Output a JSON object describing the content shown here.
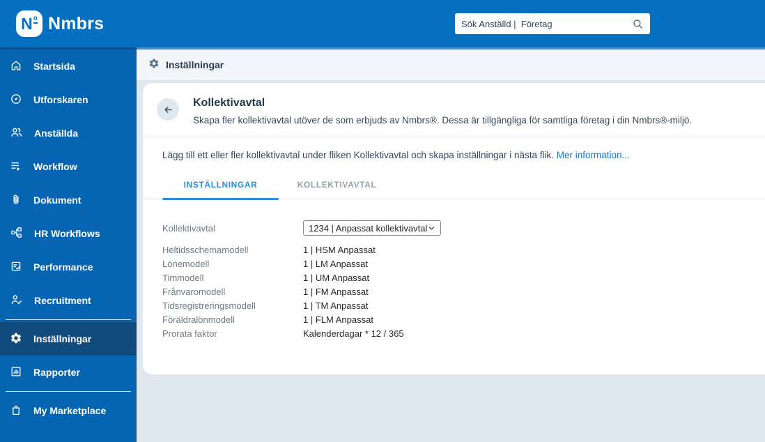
{
  "colors": {
    "brand": "#0670C0",
    "sidebar": "#0665B2",
    "sidebar_selected": "#114A7D",
    "page_bg": "#DFE7F0",
    "tab_active": "#2B90D9",
    "link": "#1878C8"
  },
  "header": {
    "logo_badge": "N",
    "logo_ordinal": "o",
    "logo_text": "Nmbrs",
    "search_placeholder": "Sök Anställd |  Företag"
  },
  "sidebar": {
    "items": [
      {
        "label": "Startsida",
        "icon": "home"
      },
      {
        "label": "Utforskaren",
        "icon": "compass"
      },
      {
        "label": "Anställda",
        "icon": "users"
      },
      {
        "label": "Workflow",
        "icon": "workflow"
      },
      {
        "label": "Dokument",
        "icon": "paperclip"
      },
      {
        "label": "HR Workflows",
        "icon": "hierarchy"
      },
      {
        "label": "Performance",
        "icon": "clipboard-check"
      },
      {
        "label": "Recruitment",
        "icon": "user-check"
      },
      {
        "label": "Inställningar",
        "icon": "gear",
        "selected": true
      },
      {
        "label": "Rapporter",
        "icon": "bar-chart"
      },
      {
        "label": "My Marketplace",
        "icon": "shopping-bag"
      }
    ]
  },
  "breadcrumb": {
    "label": "Inställningar"
  },
  "card": {
    "title": "Kollektivavtal",
    "subtitle": "Skapa fler kollektivavtal utöver de som erbjuds av Nmbrs®. Dessa är tillgängliga för samtliga företag i din Nmbrs®-miljö.",
    "info_text": "Lägg till ett eller fler kollektivavtal under fliken Kollektivavtal och skapa inställningar i nästa flik.",
    "info_link": "Mer information...",
    "tabs": [
      {
        "label": "INSTÄLLNINGAR",
        "active": true
      },
      {
        "label": "KOLLEKTIVAVTAL",
        "active": false
      }
    ],
    "form": {
      "select_label": "Kollektivavtal",
      "select_value": "1234 | Anpassat kollektivavtal",
      "rows": [
        {
          "label": "Heltidsschemamodell",
          "value": "1 | HSM Anpassat"
        },
        {
          "label": "Lönemodell",
          "value": "1 | LM Anpassat"
        },
        {
          "label": "Timmodell",
          "value": "1 | UM Anpassat"
        },
        {
          "label": "Frånvaromodell",
          "value": "1 | FM Anpassat"
        },
        {
          "label": "Tidsregistreringsmodell",
          "value": "1 | TM Anpassat"
        },
        {
          "label": "Föräldralönmodell",
          "value": "1 | FLM Anpassat"
        },
        {
          "label": "Prorata faktor",
          "value": "Kalenderdagar * 12 / 365"
        }
      ]
    }
  }
}
